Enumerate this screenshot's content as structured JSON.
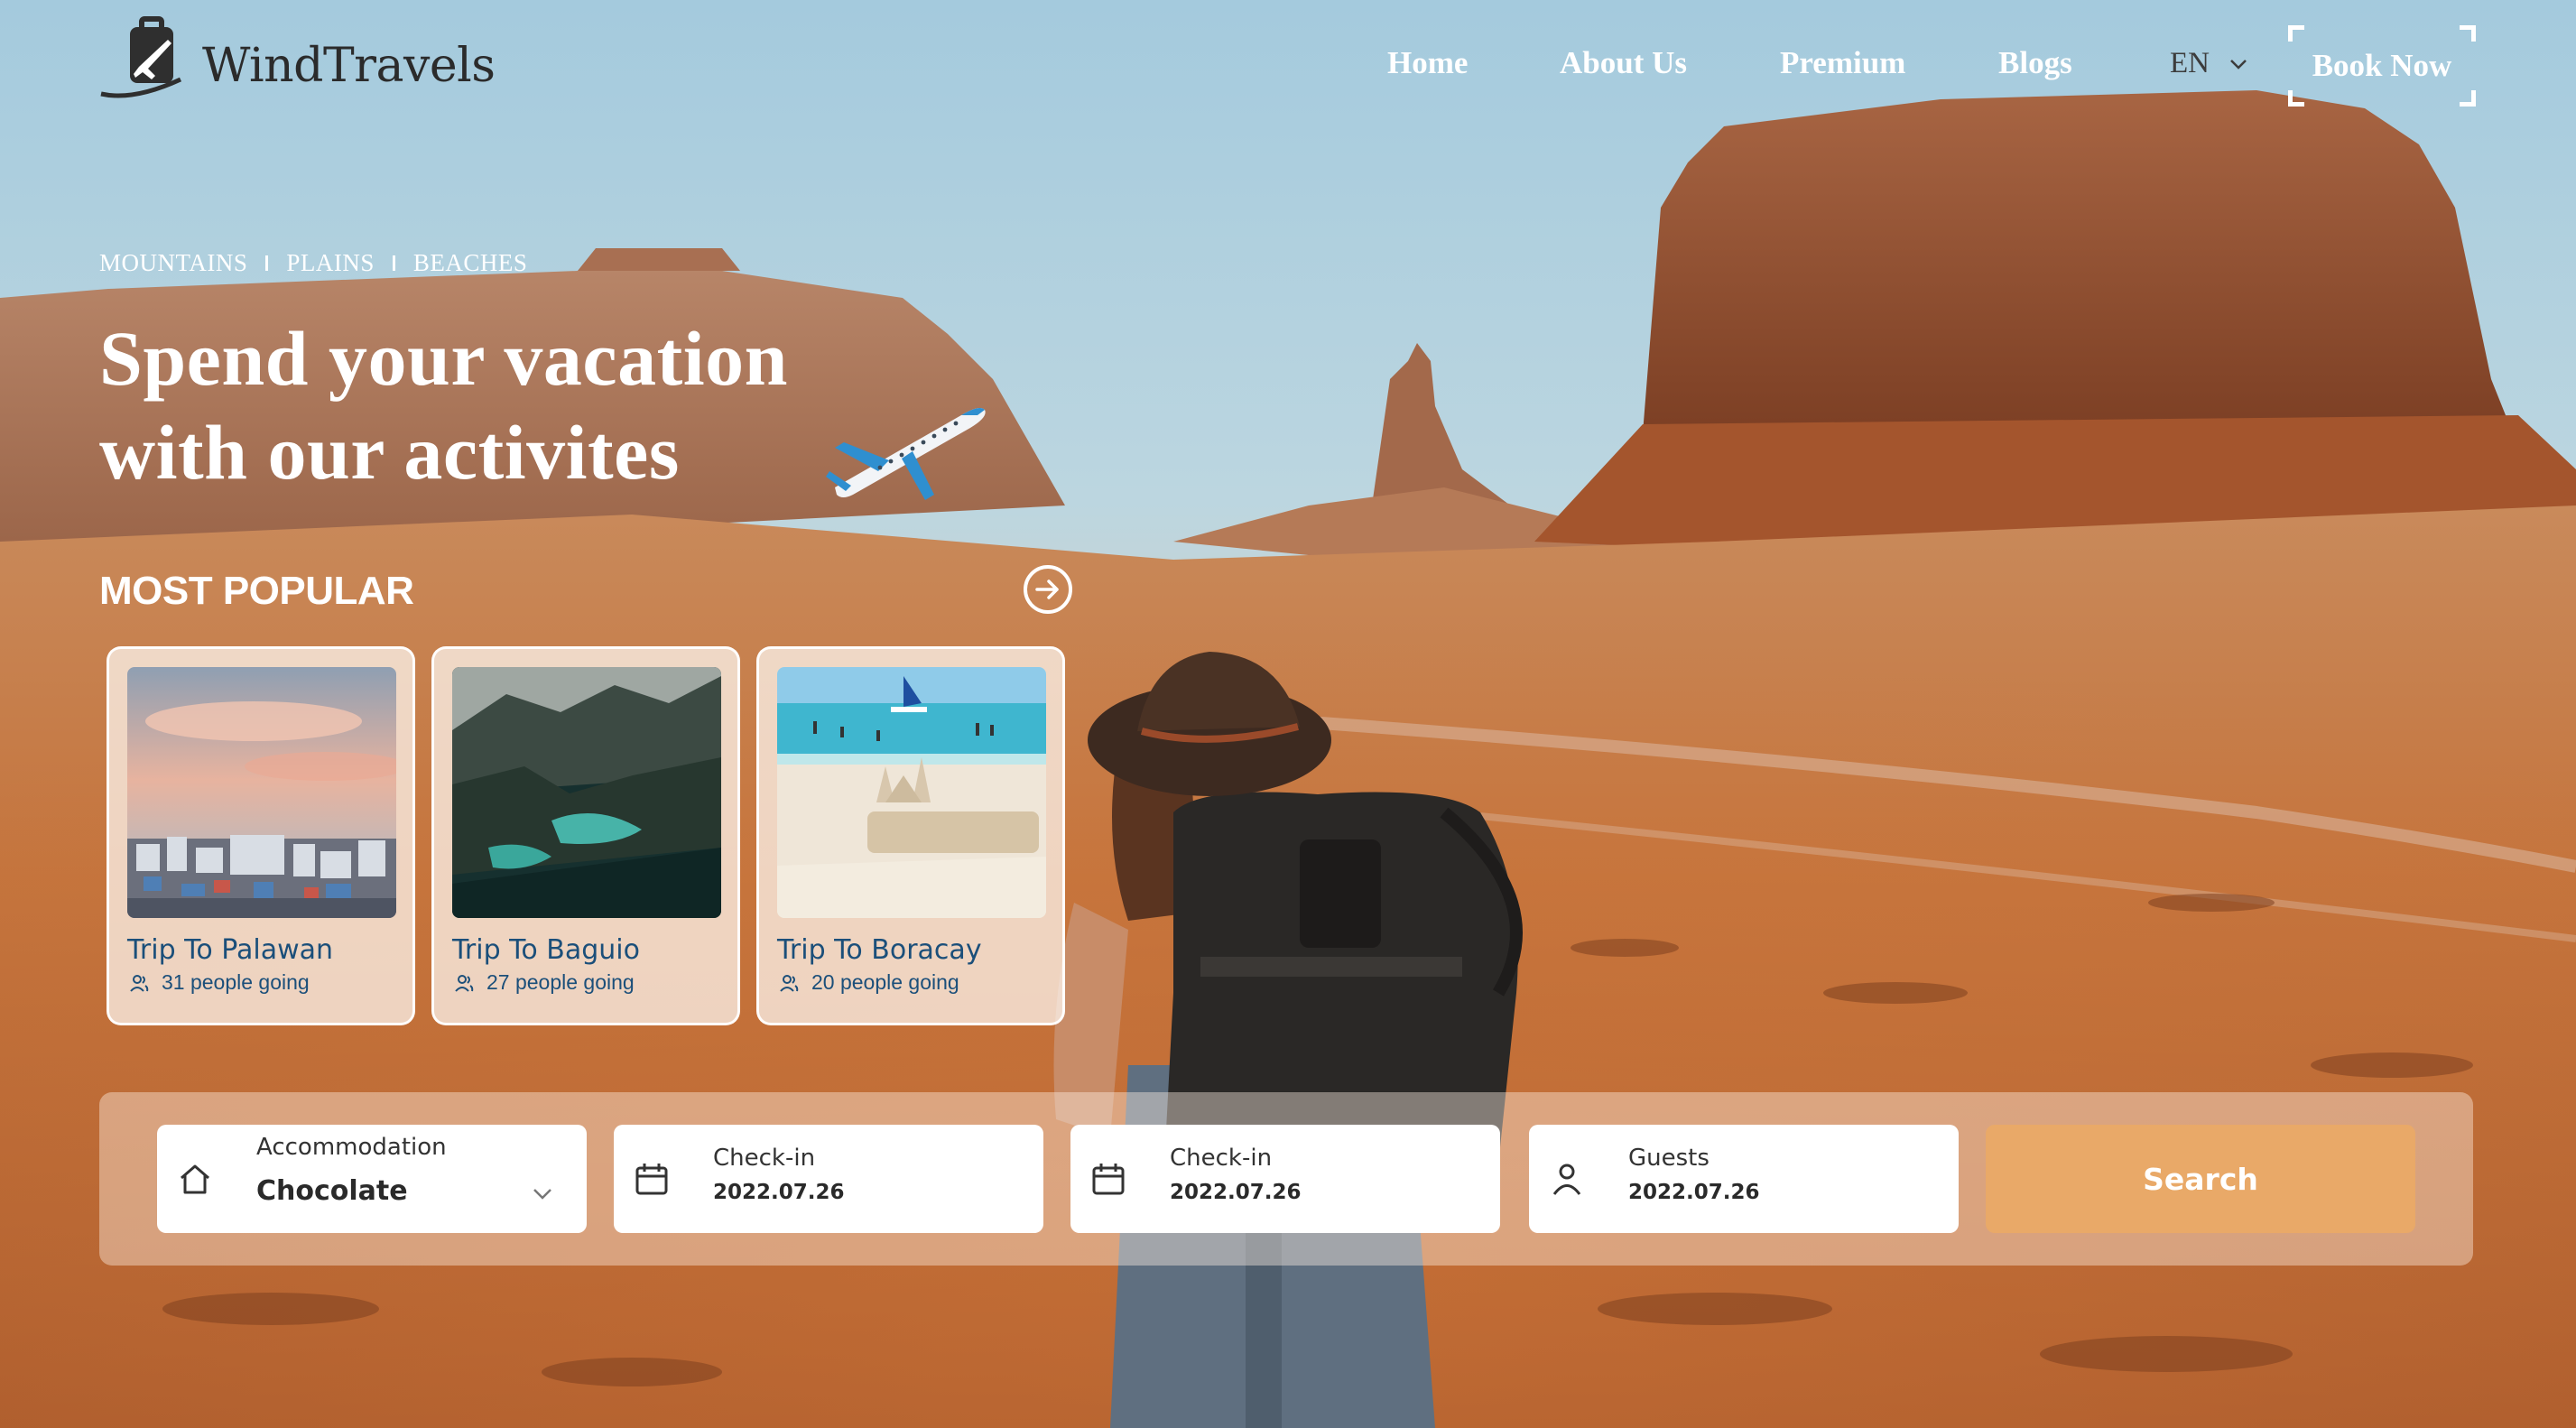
{
  "brand": {
    "name": "WindTravels"
  },
  "nav": {
    "items": [
      {
        "label": "Home"
      },
      {
        "label": "About Us"
      },
      {
        "label": "Premium"
      },
      {
        "label": "Blogs"
      }
    ],
    "language": "EN",
    "book_now": "Book Now"
  },
  "hero": {
    "categories": [
      "MOUNTAINS",
      "PLAINS",
      "BEACHES"
    ],
    "title_line1": "Spend your vacation",
    "title_line2": "with our activites"
  },
  "popular": {
    "title": "MOST POPULAR",
    "cards": [
      {
        "title": "Trip To Palawan",
        "going": "31 people going"
      },
      {
        "title": "Trip To Baguio",
        "going": "27 people going"
      },
      {
        "title": "Trip To Boracay",
        "going": "20 people going"
      }
    ]
  },
  "search": {
    "accommodation": {
      "label": "Accommodation",
      "value": "Chocolate"
    },
    "checkin_1": {
      "label": "Check-in",
      "value": "2022.07.26"
    },
    "checkin_2": {
      "label": "Check-in",
      "value": "2022.07.26"
    },
    "guests": {
      "label": "Guests",
      "value": "2022.07.26"
    },
    "button": "Search"
  },
  "colors": {
    "accent": "#e9a968",
    "card_text": "#1b4f7a",
    "sky": "#a9cde0",
    "desert": "#c9773f"
  },
  "icons": {
    "logo": "suitcase-plane-icon",
    "lang_chevron": "chevron-down-icon",
    "popular_arrow": "arrow-right-circle-icon",
    "people": "people-icon",
    "accommodation": "home-icon",
    "calendar": "calendar-icon",
    "guests": "user-icon"
  }
}
